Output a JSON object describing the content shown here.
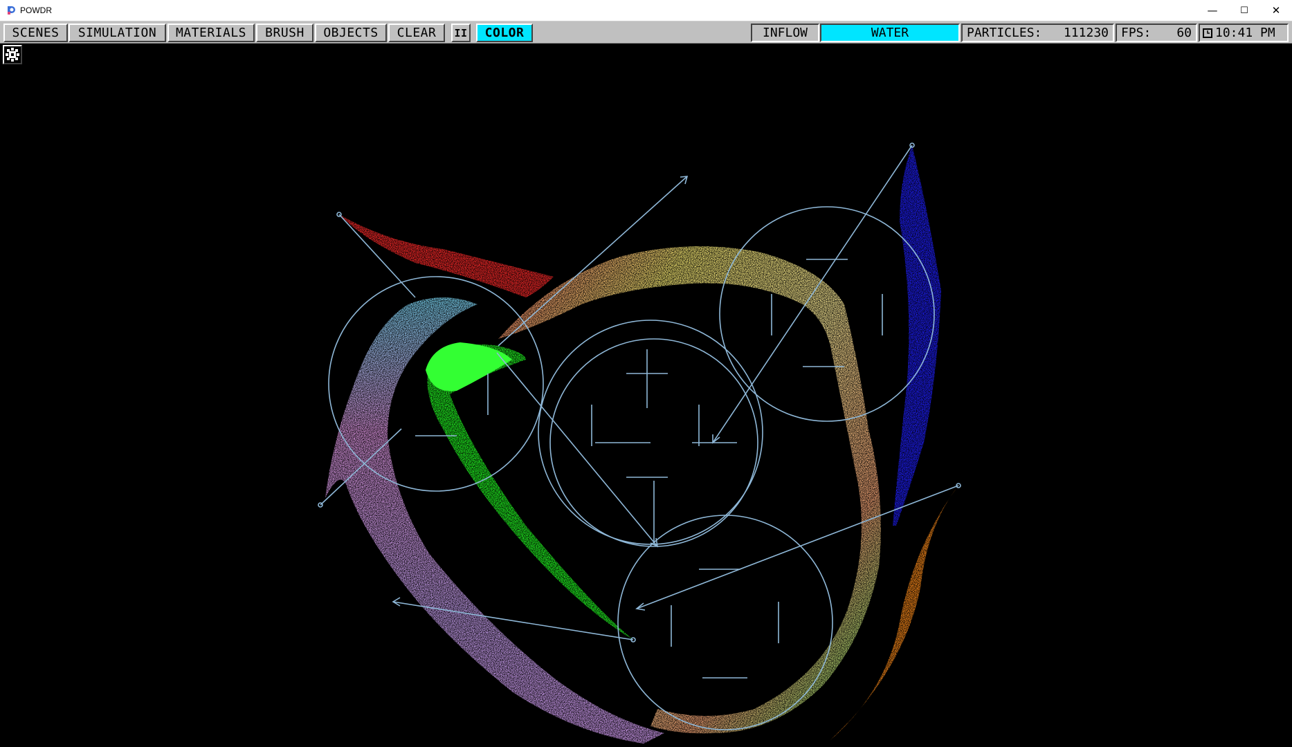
{
  "window": {
    "title": "POWDR",
    "minimize_glyph": "—",
    "maximize_glyph": "☐",
    "close_glyph": "✕"
  },
  "toolbar": {
    "menus": [
      {
        "label": "SCENES"
      },
      {
        "label": "SIMULATION"
      },
      {
        "label": "MATERIALS"
      },
      {
        "label": "BRUSH"
      },
      {
        "label": "OBJECTS"
      },
      {
        "label": "CLEAR"
      }
    ],
    "pause_glyph": "II",
    "color_label": "COLOR",
    "inflow_label": "INFLOW",
    "material_label": "WATER",
    "particles_label": "PARTICLES:",
    "particles_value": "111230",
    "fps_label": "FPS:",
    "fps_value": "60",
    "clock_time": "10:41 PM"
  },
  "colors": {
    "accent": "#00e5ff",
    "toolbar_bg": "#c0c0c0",
    "canvas_bg": "#000000",
    "gizmo_line": "#8fb8d8"
  },
  "icons": {
    "app": "powdr-logo-icon",
    "settings": "gear-icon",
    "clock": "clock-icon"
  }
}
